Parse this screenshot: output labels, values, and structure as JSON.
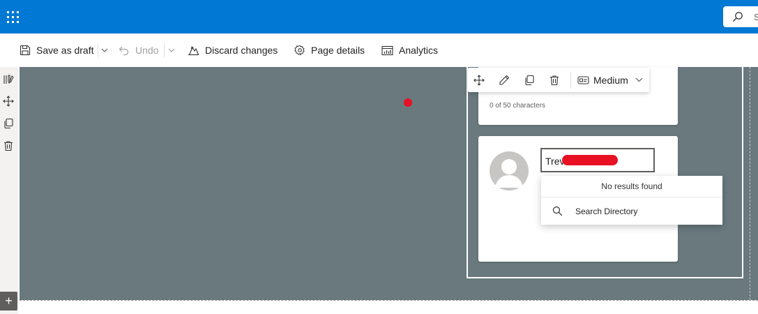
{
  "topbar": {
    "search_placeholder": "S"
  },
  "commandbar": {
    "save_draft": "Save as draft",
    "undo": "Undo",
    "discard": "Discard changes",
    "page_details": "Page details",
    "analytics": "Analytics"
  },
  "webpart_toolbar": {
    "size_value": "Medium"
  },
  "card_title": {
    "char_count": "0 of 50 characters"
  },
  "person_card": {
    "input_value": "Trev"
  },
  "people_dropdown": {
    "no_results": "No results found",
    "search_directory": "Search Directory"
  },
  "rail": {
    "add_label": "+"
  },
  "colors": {
    "brand": "#0078d4",
    "canvas": "#69797e",
    "redaction": "#e81123"
  }
}
